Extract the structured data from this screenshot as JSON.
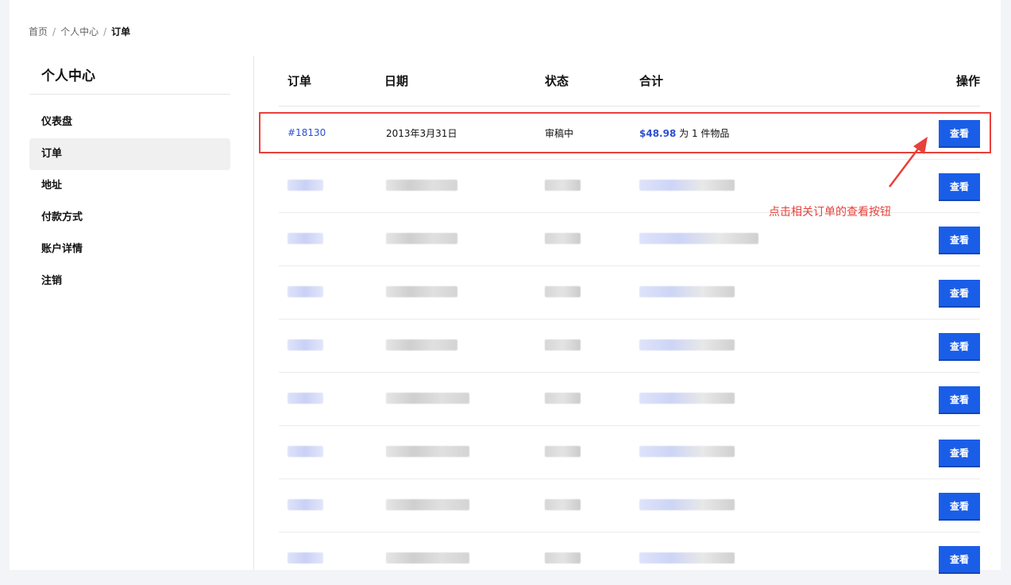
{
  "breadcrumb": {
    "home": "首页",
    "account": "个人中心",
    "current": "订单",
    "separator": "/"
  },
  "sidebar": {
    "title": "个人中心",
    "items": [
      {
        "label": "仪表盘",
        "active": false
      },
      {
        "label": "订单",
        "active": true
      },
      {
        "label": "地址",
        "active": false
      },
      {
        "label": "付款方式",
        "active": false
      },
      {
        "label": "账户详情",
        "active": false
      },
      {
        "label": "注销",
        "active": false
      }
    ]
  },
  "orders": {
    "headers": {
      "order": "订单",
      "date": "日期",
      "status": "状态",
      "total": "合计",
      "action": "操作"
    },
    "first_row": {
      "order_number": "#18130",
      "date": "2013年3月31日",
      "status": "审稿中",
      "total_amount": "$48.98",
      "total_suffix": "为 1 件物品",
      "view_label": "查看"
    },
    "view_label": "查看"
  },
  "annotation": {
    "text": "点击相关订单的查看按钮",
    "color": "#e8403a"
  },
  "colors": {
    "accent": "#1a5ee8",
    "link": "#2c4fd1",
    "highlight": "#e8403a"
  }
}
